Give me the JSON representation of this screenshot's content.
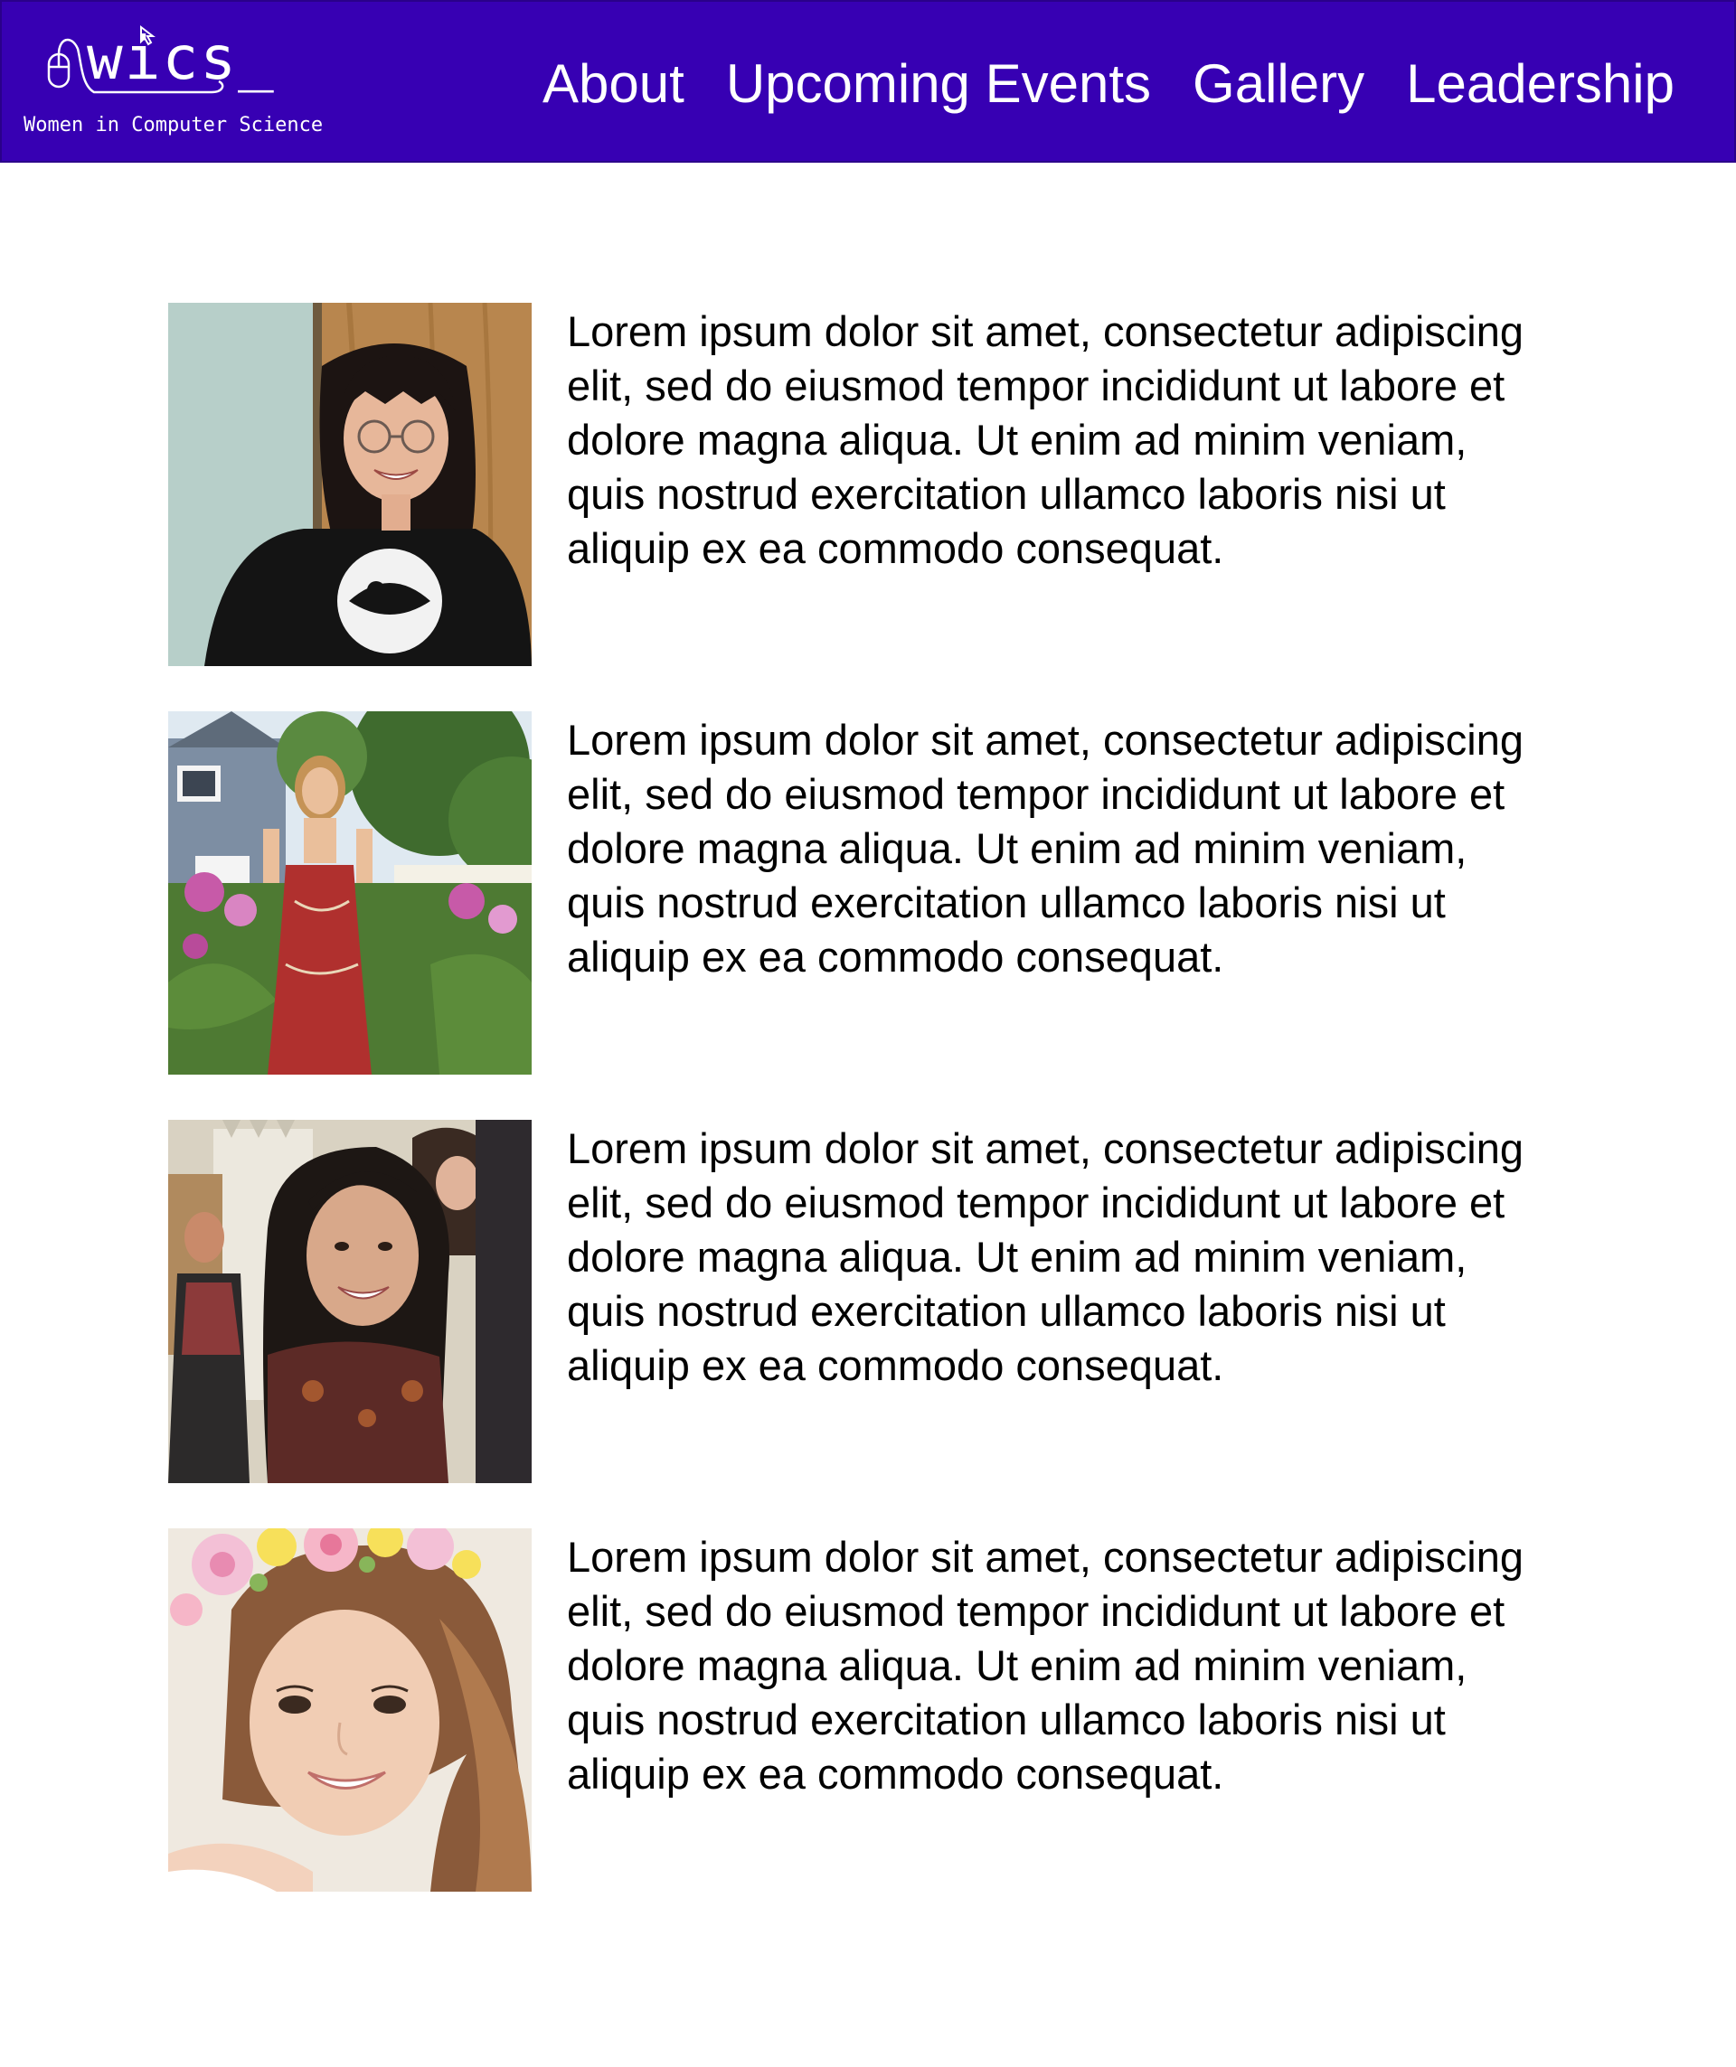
{
  "header": {
    "logo_text": "wics_",
    "logo_subtitle": "Women in Computer Science",
    "logo_icon": "computer-mouse-icon",
    "background_color": "#3700b3",
    "nav": [
      {
        "label": "About"
      },
      {
        "label": "Upcoming Events"
      },
      {
        "label": "Gallery"
      },
      {
        "label": "Leadership"
      }
    ]
  },
  "members": [
    {
      "photo": "member-photo-1",
      "bio": "Lorem ipsum dolor sit amet, consectetur adipiscing elit, sed do eiusmod tempor incididunt ut labore et dolore magna aliqua. Ut enim ad minim veniam, quis nostrud exercitation ullamco laboris nisi ut aliquip ex ea commodo consequat."
    },
    {
      "photo": "member-photo-2",
      "bio": "Lorem ipsum dolor sit amet, consectetur adipiscing elit, sed do eiusmod tempor incididunt ut labore et dolore magna aliqua. Ut enim ad minim veniam, quis nostrud exercitation ullamco laboris nisi ut aliquip ex ea commodo consequat."
    },
    {
      "photo": "member-photo-3",
      "bio": "Lorem ipsum dolor sit amet, consectetur adipiscing elit, sed do eiusmod tempor incididunt ut labore et dolore magna aliqua. Ut enim ad minim veniam, quis nostrud exercitation ullamco laboris nisi ut aliquip ex ea commodo consequat."
    },
    {
      "photo": "member-photo-4",
      "bio": "Lorem ipsum dolor sit amet, consectetur adipiscing elit, sed do eiusmod tempor incididunt ut labore et dolore magna aliqua. Ut enim ad minim veniam, quis nostrud exercitation ullamco laboris nisi ut aliquip ex ea commodo consequat."
    }
  ]
}
